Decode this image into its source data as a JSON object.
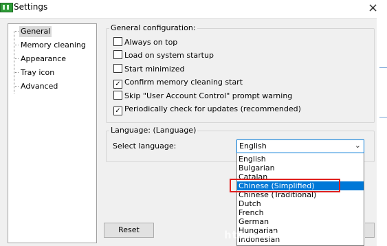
{
  "window": {
    "title": "Settings",
    "close_glyph": "×"
  },
  "sidebar": {
    "items": [
      {
        "label": "General",
        "selected": true
      },
      {
        "label": "Memory cleaning",
        "selected": false
      },
      {
        "label": "Appearance",
        "selected": false
      },
      {
        "label": "Tray icon",
        "selected": false
      },
      {
        "label": "Advanced",
        "selected": false
      }
    ]
  },
  "general": {
    "title": "General configuration:",
    "options": [
      {
        "label": "Always on top",
        "checked": false
      },
      {
        "label": "Load on system startup",
        "checked": false
      },
      {
        "label": "Start minimized",
        "checked": false
      },
      {
        "label": "Confirm memory cleaning start",
        "checked": true
      },
      {
        "label": "Skip \"User Account Control\" prompt warning",
        "checked": false
      },
      {
        "label": "Periodically check for updates (recommended)",
        "checked": true
      }
    ]
  },
  "language": {
    "title": "Language: (Language)",
    "select_label": "Select language:",
    "selected_value": "English",
    "chevron_icon": "chevron-down-icon",
    "options": [
      "English",
      "Bulgarian",
      "Catalan",
      "Chinese (Simplified)",
      "Chinese (Traditional)",
      "Dutch",
      "French",
      "German",
      "Hungarian",
      "Indonesian"
    ],
    "highlighted_option": "Chinese (Simplified)"
  },
  "buttons": {
    "reset_label": "Reset"
  },
  "colors": {
    "highlight": "#0078d7",
    "annotation": "#e0201e",
    "accent_icon": "#2e9b37"
  },
  "watermark_text": "https://blog.csdn.net"
}
